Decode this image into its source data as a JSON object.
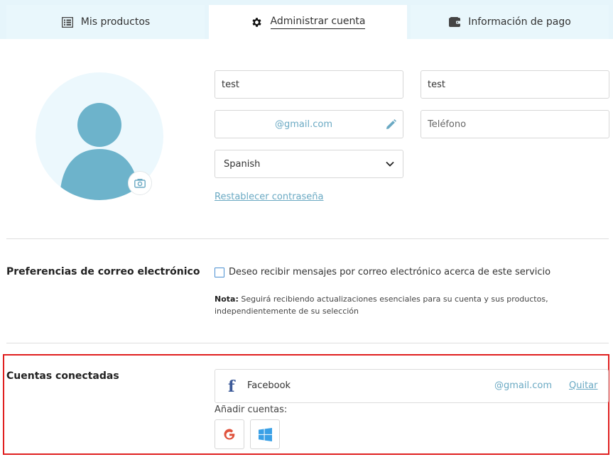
{
  "tabs": [
    {
      "label": "Mis productos",
      "icon": "list-icon"
    },
    {
      "label": "Administrar cuenta",
      "icon": "gear-icon"
    },
    {
      "label": "Información de pago",
      "icon": "wallet-icon"
    }
  ],
  "profile": {
    "first_name": "test",
    "last_name": "test",
    "email": "@gmail.com",
    "phone_placeholder": "Teléfono",
    "language": "Spanish",
    "reset_password": "Restablecer contraseña"
  },
  "email_prefs": {
    "title": "Preferencias de correo electrónico",
    "checkbox_label": "Deseo recibir mensajes por correo electrónico acerca de este servicio",
    "note_label": "Nota:",
    "note_text": " Seguirá recibiendo actualizaciones esenciales para su cuenta y sus productos, independientemente de su selección"
  },
  "connected": {
    "title": "Cuentas conectadas",
    "accounts": [
      {
        "provider": "Facebook",
        "email": "@gmail.com",
        "remove_label": "Quitar"
      }
    ],
    "add_label": "Añadir cuentas:",
    "add_options": [
      "google-icon",
      "windows-icon"
    ]
  },
  "colors": {
    "accent": "#6aa9c3",
    "avatar": "#6db3cb",
    "tab_bg": "#e6f5fb",
    "highlight": "#e01f1f"
  }
}
